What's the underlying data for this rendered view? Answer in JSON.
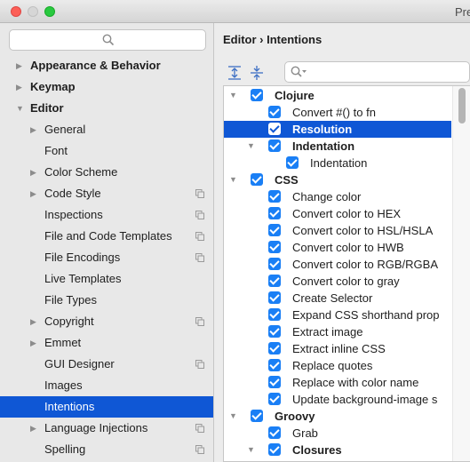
{
  "window": {
    "title": "Pre"
  },
  "sidebar": {
    "search_placeholder": "",
    "items": [
      {
        "label": "Appearance & Behavior",
        "level": 0,
        "expandable": true,
        "expanded": false,
        "bold": true
      },
      {
        "label": "Keymap",
        "level": 0,
        "expandable": true,
        "expanded": false,
        "bold": true
      },
      {
        "label": "Editor",
        "level": 0,
        "expandable": true,
        "expanded": true,
        "bold": true
      },
      {
        "label": "General",
        "level": 1,
        "expandable": true,
        "expanded": false
      },
      {
        "label": "Font",
        "level": 1,
        "expandable": false
      },
      {
        "label": "Color Scheme",
        "level": 1,
        "expandable": true,
        "expanded": false
      },
      {
        "label": "Code Style",
        "level": 1,
        "expandable": true,
        "expanded": false,
        "project_icon": true
      },
      {
        "label": "Inspections",
        "level": 1,
        "expandable": false,
        "project_icon": true
      },
      {
        "label": "File and Code Templates",
        "level": 1,
        "expandable": false,
        "project_icon": true
      },
      {
        "label": "File Encodings",
        "level": 1,
        "expandable": false,
        "project_icon": true
      },
      {
        "label": "Live Templates",
        "level": 1,
        "expandable": false
      },
      {
        "label": "File Types",
        "level": 1,
        "expandable": false
      },
      {
        "label": "Copyright",
        "level": 1,
        "expandable": true,
        "expanded": false,
        "project_icon": true
      },
      {
        "label": "Emmet",
        "level": 1,
        "expandable": true,
        "expanded": false
      },
      {
        "label": "GUI Designer",
        "level": 1,
        "expandable": false,
        "project_icon": true
      },
      {
        "label": "Images",
        "level": 1,
        "expandable": false
      },
      {
        "label": "Intentions",
        "level": 1,
        "expandable": false,
        "selected": true
      },
      {
        "label": "Language Injections",
        "level": 1,
        "expandable": true,
        "expanded": false,
        "project_icon": true
      },
      {
        "label": "Spelling",
        "level": 1,
        "expandable": false,
        "project_icon": true
      }
    ]
  },
  "content": {
    "breadcrumb": "Editor › Intentions",
    "filter_placeholder": "",
    "tree": [
      {
        "label": "Clojure",
        "level": 0,
        "group": true,
        "expanded": true,
        "checked": true
      },
      {
        "label": "Convert #() to fn",
        "level": 1,
        "checked": true
      },
      {
        "label": "Resolution",
        "level": 1,
        "checked": true,
        "bold": true,
        "selected": true
      },
      {
        "label": "Indentation",
        "level": 1,
        "group": true,
        "expanded": true,
        "checked": true
      },
      {
        "label": "Indentation",
        "level": 2,
        "checked": true
      },
      {
        "label": "CSS",
        "level": 0,
        "group": true,
        "expanded": true,
        "checked": true
      },
      {
        "label": "Change color",
        "level": 1,
        "checked": true
      },
      {
        "label": "Convert color to HEX",
        "level": 1,
        "checked": true
      },
      {
        "label": "Convert color to HSL/HSLA",
        "level": 1,
        "checked": true
      },
      {
        "label": "Convert color to HWB",
        "level": 1,
        "checked": true
      },
      {
        "label": "Convert color to RGB/RGBA",
        "level": 1,
        "checked": true
      },
      {
        "label": "Convert color to gray",
        "level": 1,
        "checked": true
      },
      {
        "label": "Create Selector",
        "level": 1,
        "checked": true
      },
      {
        "label": "Expand CSS shorthand prop",
        "level": 1,
        "checked": true
      },
      {
        "label": "Extract image",
        "level": 1,
        "checked": true
      },
      {
        "label": "Extract inline CSS",
        "level": 1,
        "checked": true
      },
      {
        "label": "Replace quotes",
        "level": 1,
        "checked": true
      },
      {
        "label": "Replace with color name",
        "level": 1,
        "checked": true
      },
      {
        "label": "Update background-image s",
        "level": 1,
        "checked": true
      },
      {
        "label": "Groovy",
        "level": 0,
        "group": true,
        "expanded": true,
        "checked": true
      },
      {
        "label": "Grab",
        "level": 1,
        "checked": true
      },
      {
        "label": "Closures",
        "level": 1,
        "group": true,
        "expanded": true,
        "checked": true
      }
    ]
  },
  "colors": {
    "selection": "#0f57d5",
    "checkbox": "#1a7ff5"
  }
}
